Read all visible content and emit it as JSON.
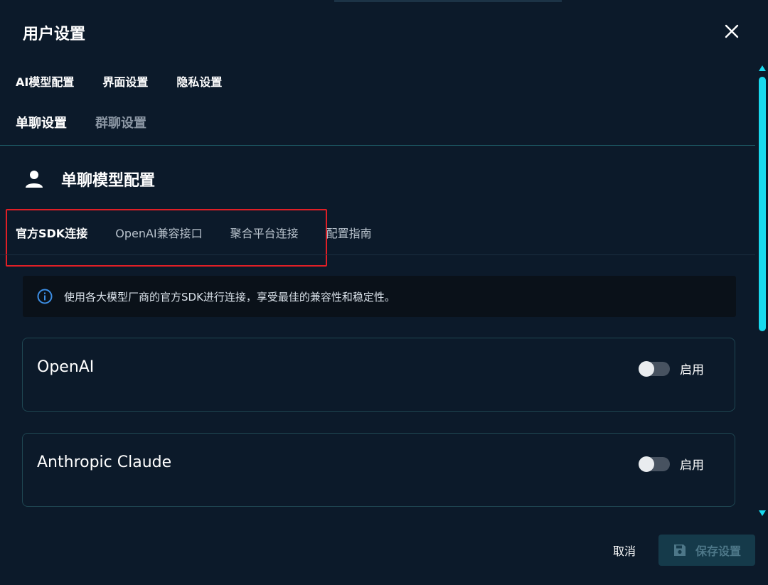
{
  "dialog": {
    "title": "用户设置",
    "close_icon": "close-icon"
  },
  "main_tabs": [
    {
      "label": "AI模型配置"
    },
    {
      "label": "界面设置"
    },
    {
      "label": "隐私设置"
    }
  ],
  "sub_tabs": [
    {
      "label": "单聊设置",
      "active": true
    },
    {
      "label": "群聊设置",
      "active": false
    }
  ],
  "section": {
    "icon": "person-icon",
    "title": "单聊模型配置"
  },
  "connection_tabs": [
    {
      "label": "官方SDK连接",
      "active": true
    },
    {
      "label": "OpenAI兼容接口",
      "active": false
    },
    {
      "label": "聚合平台连接",
      "active": false
    },
    {
      "label": "配置指南",
      "active": false
    }
  ],
  "info": {
    "icon": "info-icon",
    "text": "使用各大模型厂商的官方SDK进行连接，享受最佳的兼容性和稳定性。"
  },
  "providers": [
    {
      "name": "OpenAI",
      "toggle_label": "启用",
      "enabled": false
    },
    {
      "name": "Anthropic Claude",
      "toggle_label": "启用",
      "enabled": false
    }
  ],
  "footer": {
    "cancel_label": "取消",
    "save_label": "保存设置",
    "save_icon": "save-icon"
  },
  "colors": {
    "background": "#0c1a2a",
    "accent": "#18d9ee",
    "highlight_box": "#e01f26"
  }
}
